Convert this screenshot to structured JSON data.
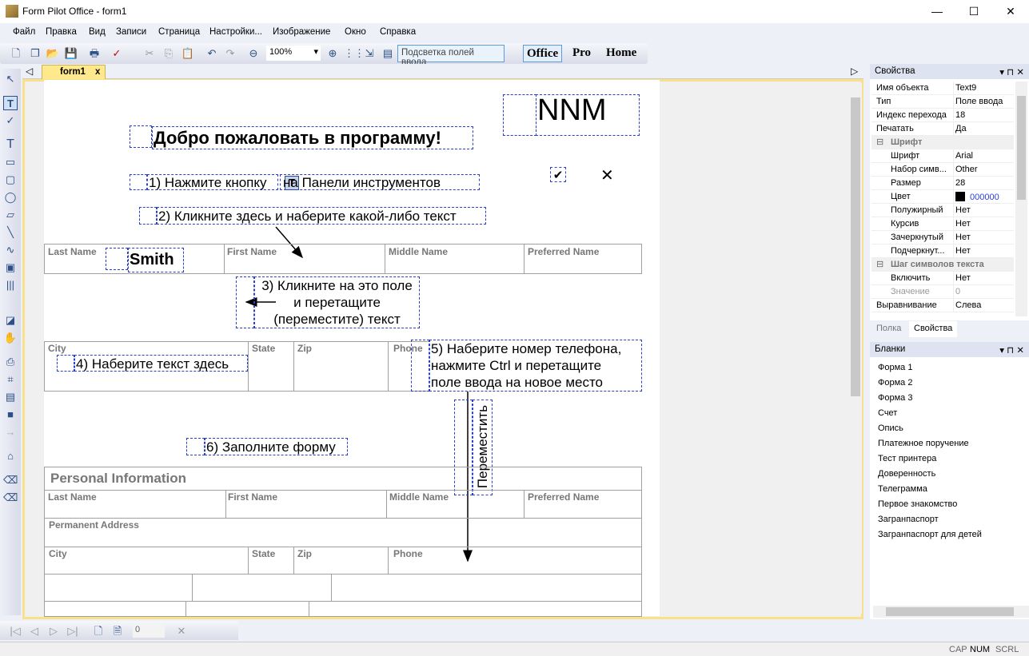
{
  "window": {
    "title": "Form Pilot Office - form1",
    "minimize": "—",
    "maximize": "☐",
    "close": "✕"
  },
  "menu": [
    "Файл",
    "Правка",
    "Вид",
    "Записи",
    "Страница",
    "Настройки...",
    "Изображение",
    "Окно",
    "Справка"
  ],
  "toolbar": {
    "zoom": "100%",
    "highlight": "Подсветка полей ввода",
    "modes": [
      "Office",
      "Pro",
      "Home"
    ],
    "active_mode": "Office"
  },
  "tab": {
    "label": "form1",
    "close": "x"
  },
  "form": {
    "nnm": "NNM",
    "check": "✔",
    "cross": "✕",
    "welcome": "Добро пожаловать в программу!",
    "step1a": "1) Нажмите кнопку",
    "step1icon": "T",
    "step1b": "на Панели инструментов",
    "step2": "2) Кликните здесь и наберите какой-либо текст",
    "table1": [
      "Last Name",
      "First Name",
      "Middle Name",
      "Preferred Name"
    ],
    "smith": "Smith",
    "step3": [
      "3) Кликните на это поле",
      "и перетащите",
      "(переместите) текст"
    ],
    "table2": [
      "City",
      "State",
      "Zip",
      "Phone"
    ],
    "step4": "4) Наберите текст здесь",
    "step5": [
      "5) Наберите номер телефона,",
      "нажмите Ctrl и перетащите",
      "поле ввода на новое место"
    ],
    "move": "Переместить",
    "step6": "6) Заполните форму",
    "personal": "Personal Information",
    "table3a": [
      "Last Name",
      "First Name",
      "Middle Name",
      "Preferred Name"
    ],
    "address": "Permanent Address",
    "table3b": [
      "City",
      "State",
      "Zip",
      "Phone"
    ]
  },
  "properties": {
    "title": "Свойства",
    "rows": [
      {
        "k": "Имя объекта",
        "v": "Text9",
        "t": "top"
      },
      {
        "k": "Тип",
        "v": "Поле ввода",
        "t": "top"
      },
      {
        "k": "Индекс перехода",
        "v": "18",
        "t": "top"
      },
      {
        "k": "Печатать",
        "v": "Да",
        "t": "top"
      },
      {
        "k": "Шрифт",
        "v": "",
        "t": "grp"
      },
      {
        "k": "Шрифт",
        "v": "Arial",
        "t": "sub"
      },
      {
        "k": "Набор симв...",
        "v": "Other",
        "t": "sub"
      },
      {
        "k": "Размер",
        "v": "28",
        "t": "sub"
      },
      {
        "k": "Цвет",
        "v": "000000",
        "t": "sub"
      },
      {
        "k": "Полужирный",
        "v": "Нет",
        "t": "sub"
      },
      {
        "k": "Курсив",
        "v": "Нет",
        "t": "sub"
      },
      {
        "k": "Зачеркнутый",
        "v": "Нет",
        "t": "sub"
      },
      {
        "k": "Подчеркнут...",
        "v": "Нет",
        "t": "sub"
      },
      {
        "k": "Шаг символов текста",
        "v": "",
        "t": "grp"
      },
      {
        "k": "Включить",
        "v": "Нет",
        "t": "sub"
      },
      {
        "k": "Значение",
        "v": "0",
        "t": "sub"
      },
      {
        "k": "Выравнивание",
        "v": "Слева",
        "t": "top"
      }
    ],
    "tabs": [
      "Полка",
      "Свойства"
    ],
    "active_tab": "Свойства",
    "color_swatch": "#000000"
  },
  "blanks": {
    "title": "Бланки",
    "items": [
      "Форма 1",
      "Форма 2",
      "Форма 3",
      "Счет",
      "Опись",
      "Платежное поручение",
      "Тест принтера",
      "Доверенность",
      "Телеграмма",
      "Первое знакомство",
      "Загранпаспорт",
      "Загранпаспорт для детей"
    ]
  },
  "nav": {
    "record": "0"
  },
  "status": {
    "cap": "CAP",
    "num": "NUM",
    "scrl": "SCRL"
  }
}
